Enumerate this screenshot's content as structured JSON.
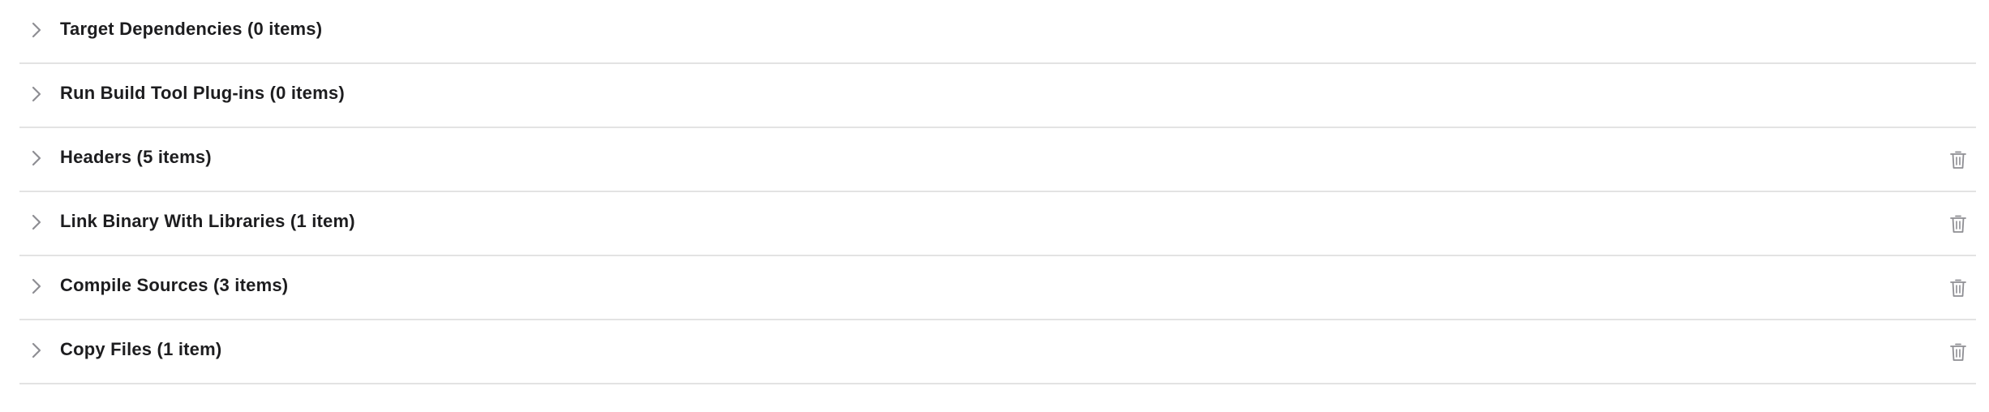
{
  "build_phases": [
    {
      "title": "Target Dependencies (0 items)",
      "deletable": false,
      "icon": "chevron-right-icon"
    },
    {
      "title": "Run Build Tool Plug-ins (0 items)",
      "deletable": false,
      "icon": "chevron-right-icon"
    },
    {
      "title": "Headers (5 items)",
      "deletable": true,
      "icon": "chevron-right-icon",
      "delete_icon": "trash-icon"
    },
    {
      "title": "Link Binary With Libraries (1 item)",
      "deletable": true,
      "icon": "chevron-right-icon",
      "delete_icon": "trash-icon"
    },
    {
      "title": "Compile Sources (3 items)",
      "deletable": true,
      "icon": "chevron-right-icon",
      "delete_icon": "trash-icon"
    },
    {
      "title": "Copy Files (1 item)",
      "deletable": true,
      "icon": "chevron-right-icon",
      "delete_icon": "trash-icon"
    }
  ],
  "colors": {
    "text": "#1d1d1f",
    "chevron": "#8e8e93",
    "trash": "#8e8e93",
    "divider": "#e3e3e3"
  }
}
